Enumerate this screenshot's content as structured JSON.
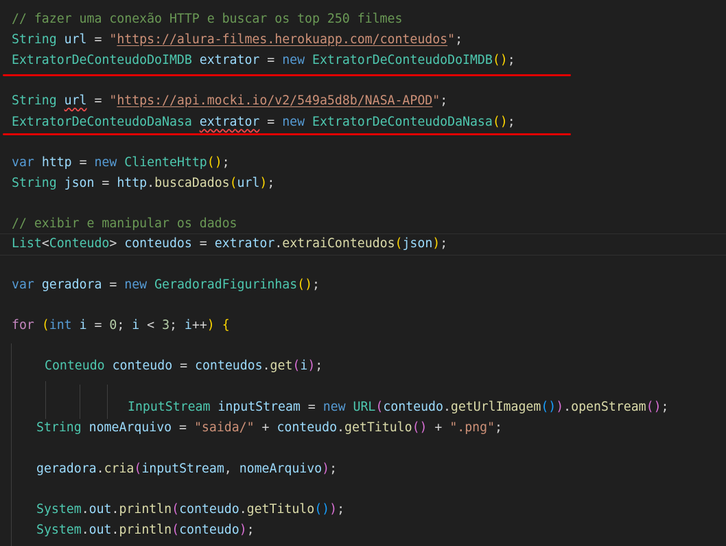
{
  "editor": {
    "lines": [
      {
        "id": "l1",
        "tokens": [
          [
            "comment",
            "// fazer uma conexão HTTP e buscar os top 250 filmes"
          ]
        ]
      },
      {
        "id": "l2",
        "tokens": [
          [
            "type",
            "String"
          ],
          [
            "plain",
            " "
          ],
          [
            "var",
            "url"
          ],
          [
            "plain",
            " = "
          ],
          [
            "string",
            "\""
          ],
          [
            "url",
            "https://alura-filmes.herokuapp.com/conteudos"
          ],
          [
            "string",
            "\""
          ],
          [
            "plain",
            ";"
          ]
        ]
      },
      {
        "id": "l3",
        "tokens": [
          [
            "type",
            "ExtratorDeConteudoDoIMDB"
          ],
          [
            "plain",
            " "
          ],
          [
            "var",
            "extrator"
          ],
          [
            "plain",
            " = "
          ],
          [
            "kw",
            "new"
          ],
          [
            "plain",
            " "
          ],
          [
            "type",
            "ExtratorDeConteudoDoIMDB"
          ],
          [
            "paren1",
            "()"
          ],
          [
            "plain",
            ";"
          ]
        ]
      },
      {
        "id": "l4",
        "tokens": [
          [
            "type",
            "String"
          ],
          [
            "plain",
            " "
          ],
          [
            "var-sq",
            "url"
          ],
          [
            "plain",
            " = "
          ],
          [
            "string",
            "\""
          ],
          [
            "url",
            "https://api.mocki.io/v2/549a5d8b/NASA-APOD"
          ],
          [
            "string",
            "\""
          ],
          [
            "plain",
            ";"
          ]
        ]
      },
      {
        "id": "l5",
        "tokens": [
          [
            "type",
            "ExtratorDeConteudoDaNasa"
          ],
          [
            "plain",
            " "
          ],
          [
            "var-sq",
            "extrator"
          ],
          [
            "plain",
            " = "
          ],
          [
            "kw",
            "new"
          ],
          [
            "plain",
            " "
          ],
          [
            "type",
            "ExtratorDeConteudoDaNasa"
          ],
          [
            "paren1",
            "()"
          ],
          [
            "plain",
            ";"
          ]
        ]
      },
      {
        "id": "l6",
        "tokens": [
          [
            "kw",
            "var"
          ],
          [
            "plain",
            " "
          ],
          [
            "var",
            "http"
          ],
          [
            "plain",
            " = "
          ],
          [
            "kw",
            "new"
          ],
          [
            "plain",
            " "
          ],
          [
            "type",
            "ClienteHttp"
          ],
          [
            "paren1",
            "()"
          ],
          [
            "plain",
            ";"
          ]
        ]
      },
      {
        "id": "l7",
        "tokens": [
          [
            "type",
            "String"
          ],
          [
            "plain",
            " "
          ],
          [
            "var",
            "json"
          ],
          [
            "plain",
            " = "
          ],
          [
            "var",
            "http"
          ],
          [
            "plain",
            "."
          ],
          [
            "fn",
            "buscaDados"
          ],
          [
            "paren1",
            "("
          ],
          [
            "var",
            "url"
          ],
          [
            "paren1",
            ")"
          ],
          [
            "plain",
            ";"
          ]
        ]
      },
      {
        "id": "l8",
        "tokens": [
          [
            "comment",
            "// exibir e manipular os dados"
          ]
        ]
      },
      {
        "id": "l9",
        "tokens": [
          [
            "type",
            "List"
          ],
          [
            "plain",
            "<"
          ],
          [
            "type",
            "Conteudo"
          ],
          [
            "plain",
            "> "
          ],
          [
            "var",
            "conteudos"
          ],
          [
            "plain",
            " = "
          ],
          [
            "var",
            "extrator"
          ],
          [
            "plain",
            "."
          ],
          [
            "fn",
            "extraiConteudos"
          ],
          [
            "paren1",
            "("
          ],
          [
            "var",
            "json"
          ],
          [
            "paren1",
            ")"
          ],
          [
            "plain",
            ";"
          ]
        ]
      },
      {
        "id": "l10",
        "tokens": [
          [
            "kw",
            "var"
          ],
          [
            "plain",
            " "
          ],
          [
            "var",
            "geradora"
          ],
          [
            "plain",
            " = "
          ],
          [
            "kw",
            "new"
          ],
          [
            "plain",
            " "
          ],
          [
            "type",
            "GeradoradFigurinhas"
          ],
          [
            "paren1",
            "()"
          ],
          [
            "plain",
            ";"
          ]
        ]
      },
      {
        "id": "l11",
        "tokens": [
          [
            "kw2",
            "for"
          ],
          [
            "plain",
            " "
          ],
          [
            "paren1",
            "("
          ],
          [
            "kw",
            "int"
          ],
          [
            "plain",
            " "
          ],
          [
            "var",
            "i"
          ],
          [
            "plain",
            " = "
          ],
          [
            "num",
            "0"
          ],
          [
            "plain",
            "; "
          ],
          [
            "var",
            "i"
          ],
          [
            "plain",
            " < "
          ],
          [
            "num",
            "3"
          ],
          [
            "plain",
            "; "
          ],
          [
            "var",
            "i"
          ],
          [
            "plain",
            "++"
          ],
          [
            "paren1",
            ")"
          ],
          [
            "plain",
            " "
          ],
          [
            "paren1",
            "{"
          ]
        ]
      },
      {
        "id": "l12",
        "tokens": [
          [
            "type",
            "Conteudo"
          ],
          [
            "plain",
            " "
          ],
          [
            "var",
            "conteudo"
          ],
          [
            "plain",
            " = "
          ],
          [
            "var",
            "conteudos"
          ],
          [
            "plain",
            "."
          ],
          [
            "fn",
            "get"
          ],
          [
            "paren2",
            "("
          ],
          [
            "var",
            "i"
          ],
          [
            "paren2",
            ")"
          ],
          [
            "plain",
            ";"
          ]
        ]
      },
      {
        "id": "l13",
        "tokens": [
          [
            "type",
            "InputStream"
          ],
          [
            "plain",
            " "
          ],
          [
            "var",
            "inputStream"
          ],
          [
            "plain",
            " = "
          ],
          [
            "kw",
            "new"
          ],
          [
            "plain",
            " "
          ],
          [
            "type",
            "URL"
          ],
          [
            "paren2",
            "("
          ],
          [
            "var",
            "conteudo"
          ],
          [
            "plain",
            "."
          ],
          [
            "fn",
            "getUrlImagem"
          ],
          [
            "paren3",
            "()"
          ],
          [
            "paren2",
            ")"
          ],
          [
            "plain",
            "."
          ],
          [
            "fn",
            "openStream"
          ],
          [
            "paren2",
            "()"
          ],
          [
            "plain",
            ";"
          ]
        ]
      },
      {
        "id": "l14",
        "tokens": [
          [
            "type",
            "String"
          ],
          [
            "plain",
            " "
          ],
          [
            "var",
            "nomeArquivo"
          ],
          [
            "plain",
            " = "
          ],
          [
            "string",
            "\"saida/\""
          ],
          [
            "plain",
            " + "
          ],
          [
            "var",
            "conteudo"
          ],
          [
            "plain",
            "."
          ],
          [
            "fn",
            "getTitulo"
          ],
          [
            "paren2",
            "()"
          ],
          [
            "plain",
            " + "
          ],
          [
            "string",
            "\".png\""
          ],
          [
            "plain",
            ";"
          ]
        ]
      },
      {
        "id": "l15",
        "tokens": [
          [
            "var",
            "geradora"
          ],
          [
            "plain",
            "."
          ],
          [
            "fn",
            "cria"
          ],
          [
            "paren2",
            "("
          ],
          [
            "var",
            "inputStream"
          ],
          [
            "plain",
            ", "
          ],
          [
            "var",
            "nomeArquivo"
          ],
          [
            "paren2",
            ")"
          ],
          [
            "plain",
            ";"
          ]
        ]
      },
      {
        "id": "l16",
        "tokens": [
          [
            "type",
            "System"
          ],
          [
            "plain",
            "."
          ],
          [
            "var",
            "out"
          ],
          [
            "plain",
            "."
          ],
          [
            "fn",
            "println"
          ],
          [
            "paren2",
            "("
          ],
          [
            "var",
            "conteudo"
          ],
          [
            "plain",
            "."
          ],
          [
            "fn",
            "getTitulo"
          ],
          [
            "paren3",
            "()"
          ],
          [
            "paren2",
            ")"
          ],
          [
            "plain",
            ";"
          ]
        ]
      },
      {
        "id": "l17",
        "tokens": [
          [
            "type",
            "System"
          ],
          [
            "plain",
            "."
          ],
          [
            "var",
            "out"
          ],
          [
            "plain",
            "."
          ],
          [
            "fn",
            "println"
          ],
          [
            "paren2",
            "("
          ],
          [
            "var",
            "conteudo"
          ],
          [
            "paren2",
            ")"
          ],
          [
            "plain",
            ";"
          ]
        ]
      }
    ]
  },
  "colors": {
    "background": "#1f1f1f",
    "annotation_underline": "#e00000"
  }
}
